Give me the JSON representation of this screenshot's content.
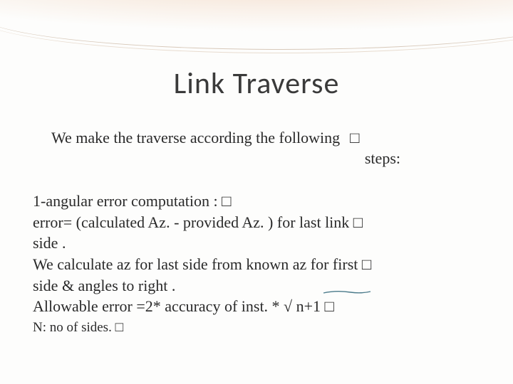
{
  "title": "Link    Traverse",
  "intro": {
    "line1": "We  make the traverse  according  the  following",
    "box1": "□",
    "line2": "steps:"
  },
  "body": {
    "r1": "1-angular  error  computation :  □",
    "r2": " error=  (calculated  Az. -  provided Az. ) for  last  link   □",
    "r3": "side .",
    "r4": "We calculate az for  last side from  known az for first   □",
    "r5": "side  & angles to right .",
    "r6": "Allowable  error =2* accuracy of inst. * √ n+1  □",
    "r7": "N: no of sides.  □"
  }
}
